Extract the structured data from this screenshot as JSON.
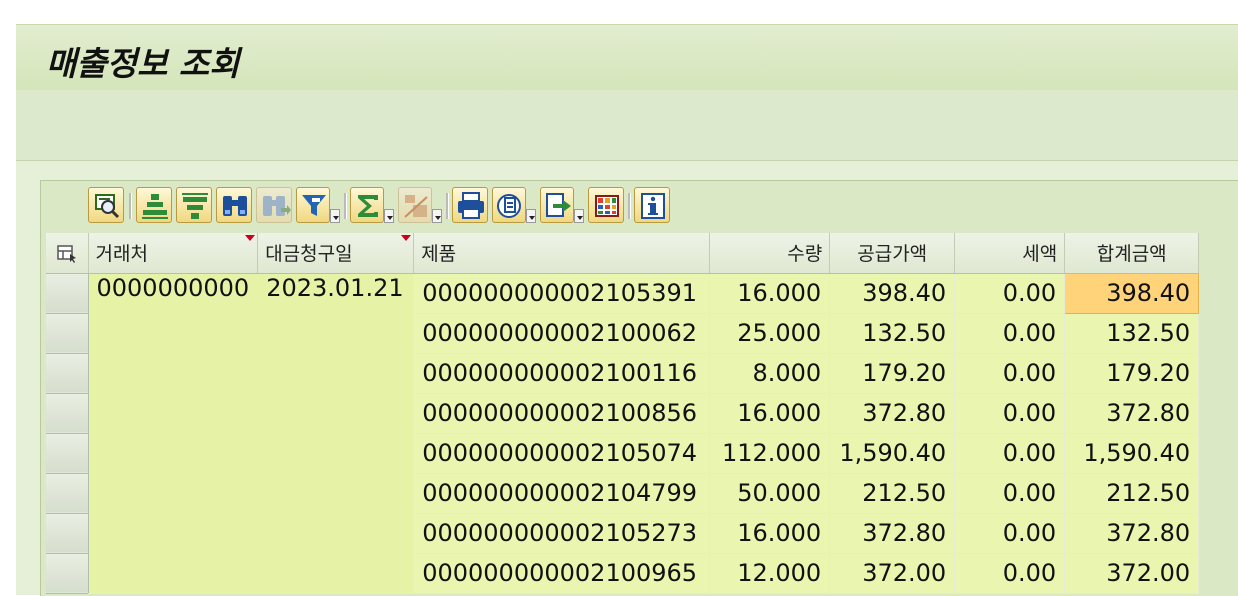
{
  "page": {
    "title": "매출정보 조회"
  },
  "toolbar": {
    "buttons": [
      {
        "name": "details-button",
        "icon": "magnifier-details-icon"
      },
      {
        "name": "sort-ascending-button",
        "icon": "sort-ascending-icon"
      },
      {
        "name": "sort-descending-button",
        "icon": "sort-descending-icon"
      },
      {
        "name": "find-button",
        "icon": "binoculars-icon"
      },
      {
        "name": "find-next-button",
        "icon": "binoculars-next-icon"
      },
      {
        "name": "filter-button",
        "icon": "funnel-filter-icon"
      },
      {
        "name": "total-button",
        "icon": "sigma-icon"
      },
      {
        "name": "subtotal-button",
        "icon": "subtotal-icon"
      },
      {
        "name": "print-button",
        "icon": "printer-icon"
      },
      {
        "name": "views-button",
        "icon": "views-icon"
      },
      {
        "name": "export-button",
        "icon": "export-icon"
      },
      {
        "name": "layout-button",
        "icon": "grid-layout-icon"
      },
      {
        "name": "info-button",
        "icon": "info-icon"
      }
    ]
  },
  "grid": {
    "columns": [
      {
        "key": "customer",
        "label": "거래처",
        "sorted": true
      },
      {
        "key": "billing_date",
        "label": "대금청구일",
        "sorted": true
      },
      {
        "key": "product",
        "label": "제품"
      },
      {
        "key": "qty",
        "label": "수량"
      },
      {
        "key": "supply_amount",
        "label": "공급가액"
      },
      {
        "key": "tax",
        "label": "세액"
      },
      {
        "key": "total",
        "label": "합계금액"
      }
    ],
    "customer": "0000000000",
    "billing_date": "2023.01.21",
    "rows": [
      {
        "product": "000000000002105391",
        "qty": "16.000",
        "supply_amount": "398.40",
        "tax": "0.00",
        "total": "398.40"
      },
      {
        "product": "000000000002100062",
        "qty": "25.000",
        "supply_amount": "132.50",
        "tax": "0.00",
        "total": "132.50"
      },
      {
        "product": "000000000002100116",
        "qty": "8.000",
        "supply_amount": "179.20",
        "tax": "0.00",
        "total": "179.20"
      },
      {
        "product": "000000000002100856",
        "qty": "16.000",
        "supply_amount": "372.80",
        "tax": "0.00",
        "total": "372.80"
      },
      {
        "product": "000000000002105074",
        "qty": "112.000",
        "supply_amount": "1,590.40",
        "tax": "0.00",
        "total": "1,590.40"
      },
      {
        "product": "000000000002104799",
        "qty": "50.000",
        "supply_amount": "212.50",
        "tax": "0.00",
        "total": "212.50"
      },
      {
        "product": "000000000002105273",
        "qty": "16.000",
        "supply_amount": "372.80",
        "tax": "0.00",
        "total": "372.80"
      },
      {
        "product": "000000000002100965",
        "qty": "12.000",
        "supply_amount": "372.00",
        "tax": "0.00",
        "total": "372.00"
      }
    ],
    "highlight_color": "#ffd37a",
    "key_column_color": "#e6f2a6",
    "data_color": "#eaf6b0"
  }
}
